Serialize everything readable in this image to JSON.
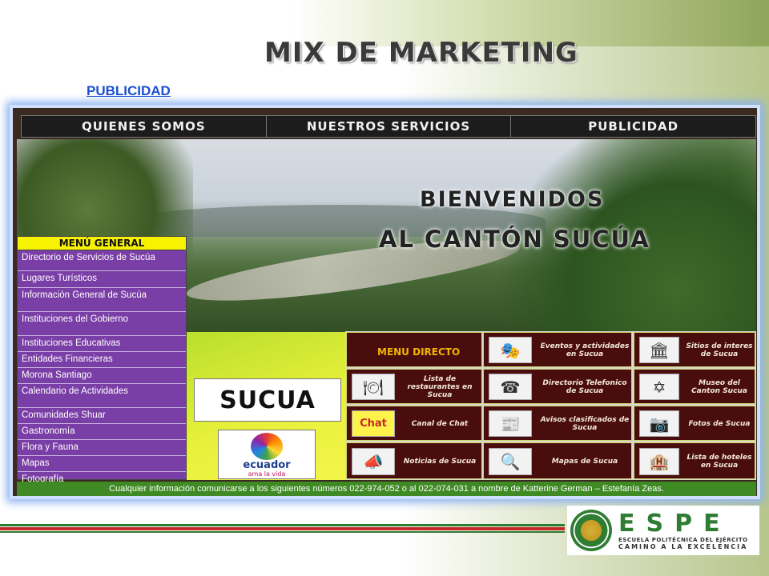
{
  "slide": {
    "title": "MIX DE MARKETING",
    "link_label": "PUBLICIDAD"
  },
  "site": {
    "nav": [
      "QUIENES SOMOS",
      "NUESTROS SERVICIOS",
      "PUBLICIDAD"
    ],
    "welcome_line1": "BIENVENIDOS",
    "welcome_line2": "AL CANTÓN SUCÚA",
    "menu_general": {
      "title": "MENÚ GENERAL",
      "items": [
        "Directorio de Servicios de Sucúa",
        "Lugares Turísticos",
        "Información General de Sucúa",
        "Instituciones del Gobierno",
        "Instituciones Educativas",
        "Entidades Financieras",
        "Morona Santiago",
        "Calendario de Actividades",
        "Comunidades Shuar",
        "Gastronomía",
        "Flora y Fauna",
        "Mapas",
        "Fotografía"
      ]
    },
    "logos": {
      "sucua": "SUCUA",
      "ecuador": "ecuador",
      "ecuador_tagline": "ama la vida"
    },
    "menu_directo": {
      "title": "MENU DIRECTO",
      "cells": [
        {
          "label": "Eventos y actividades en Sucua",
          "icon": "theater-masks-icon",
          "glyph": "🎭"
        },
        {
          "label": "Sitios de interes de Sucua",
          "icon": "building-columns-icon",
          "glyph": "🏛"
        },
        {
          "label": "Lista de restaurantes en Sucua",
          "icon": "plate-cutlery-icon",
          "glyph": "🍽"
        },
        {
          "label": "Directorio Telefonico de Sucua",
          "icon": "telephone-icon",
          "glyph": "☎"
        },
        {
          "label": "Museo del Canton Sucua",
          "icon": "museum-icon",
          "glyph": "✡"
        },
        {
          "label": "Canal de Chat",
          "icon": "chat-icon",
          "glyph": "Chat"
        },
        {
          "label": "Avisos clasificados de Sucua",
          "icon": "classifieds-icon",
          "glyph": "📰"
        },
        {
          "label": "Fotos de Sucua",
          "icon": "camera-icon",
          "glyph": "📷"
        },
        {
          "label": "Noticias de Sucua",
          "icon": "newspaper-reader-icon",
          "glyph": "📣"
        },
        {
          "label": "Mapas de Sucua",
          "icon": "map-magnifier-icon",
          "glyph": "🔍"
        },
        {
          "label": "Lista de hoteles en Sucua",
          "icon": "hotel-icon",
          "glyph": "🏨"
        }
      ]
    },
    "footer": "Cualquier información comunicarse a los siguientes números 022-974-052 o al 022-074-031 a nombre de Katterine German – Estefanía Zeas."
  },
  "branding": {
    "letters": "ESPE",
    "sub1": "ESCUELA POLITÉCNICA DEL EJÉRCITO",
    "sub2": "CAMINO A LA EXCELENCIA"
  }
}
